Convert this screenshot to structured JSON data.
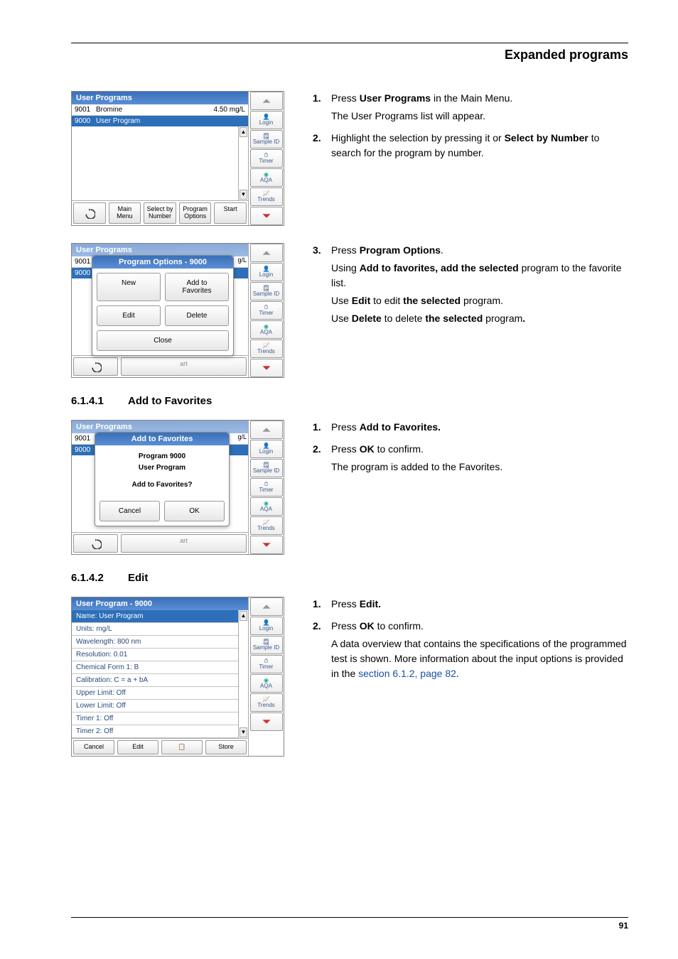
{
  "header": {
    "title": "Expanded programs"
  },
  "page_number": "91",
  "steps1": [
    {
      "num": "1.",
      "lines": [
        "Press <b>User Programs</b> in the Main Menu.",
        "The User Programs list will appear."
      ]
    },
    {
      "num": "2.",
      "lines": [
        "Highlight the selection by pressing it or <b>Select by Number</b> to search for the program by number."
      ]
    }
  ],
  "steps2": [
    {
      "num": "3.",
      "lines": [
        "Press <b>Program Options</b>.",
        "Using <b>Add to favorites, add the selected</b> program to the favorite list.",
        "Use <b>Edit</b> to edit <b>the selected</b> program.",
        "Use <b>Delete</b> to delete <b>the selected</b> program<b>.</b>"
      ]
    }
  ],
  "section_addfav": {
    "num": "6.1.4.1",
    "title": "Add to Favorites"
  },
  "steps3": [
    {
      "num": "1.",
      "lines": [
        "Press <b>Add to Favorites.</b>"
      ]
    },
    {
      "num": "2.",
      "lines": [
        "Press <b>OK</b> to confirm.",
        "The program is added to the Favorites."
      ]
    }
  ],
  "section_edit": {
    "num": "6.1.4.2",
    "title": "Edit"
  },
  "steps4": [
    {
      "num": "1.",
      "lines": [
        "Press <b>Edit.</b>"
      ]
    },
    {
      "num": "2.",
      "lines": [
        "Press <b>OK</b> to confirm.",
        "A data overview that contains the specifications of the programmed test is shown. More information about the input options is provided in the <span class=\"link\">section 6.1.2, page 82</span>."
      ]
    }
  ],
  "sidebar_labels": {
    "login": "Login",
    "sample": "Sample ID",
    "timer": "Timer",
    "aqa": "AQA",
    "trends": "Trends"
  },
  "device1": {
    "title": "User Programs",
    "rows": [
      {
        "id": "9001",
        "name": "Bromine",
        "val": "4.50 mg/L"
      },
      {
        "id": "9000",
        "name": "User Program",
        "val": ""
      }
    ],
    "buttons": {
      "back": "↶",
      "main": "Main\nMenu",
      "select": "Select by\nNumber",
      "options": "Program\nOptions",
      "start": "Start"
    }
  },
  "device2": {
    "title_bg": "User Programs",
    "popup_title": "Program Options - 9000",
    "btns": {
      "new": "New",
      "add": "Add to\nFavorites",
      "edit": "Edit",
      "del": "Delete",
      "close": "Close"
    },
    "suffix": "art",
    "gL": "g/L"
  },
  "device3": {
    "title_bg": "User Programs",
    "popup_title": "Add to Favorites",
    "msg1": "Program 9000",
    "msg2": "User Program",
    "msg3": "Add to Favorites?",
    "cancel": "Cancel",
    "ok": "OK",
    "suffix": "art",
    "gL": "g/L"
  },
  "device4": {
    "title": "User Program - 9000",
    "rows": [
      "Name: User Program",
      "Units: mg/L",
      "Wavelength: 800 nm",
      "Resolution: 0.01",
      "Chemical Form 1: B",
      "Calibration: C = a + bA",
      "Upper Limit: Off",
      "Lower Limit: Off",
      "Timer 1: Off",
      "Timer 2: Off"
    ],
    "buttons": {
      "cancel": "Cancel",
      "edit": "Edit",
      "icon": "📋",
      "store": "Store"
    }
  }
}
